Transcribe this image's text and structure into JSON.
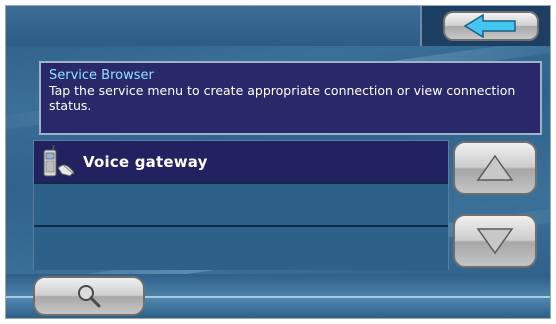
{
  "header": {
    "back_icon": "back-arrow-icon"
  },
  "info": {
    "title": "Service Browser",
    "description": "Tap the service menu to create appropriate connection or view connection status."
  },
  "services": [
    {
      "label": "Voice gateway",
      "icon": "phone-signal-icon"
    },
    {
      "label": ""
    },
    {
      "label": ""
    }
  ],
  "scroll": {
    "up_icon": "triangle-up-icon",
    "down_icon": "triangle-down-icon"
  },
  "footer": {
    "search_icon": "magnifier-icon"
  },
  "colors": {
    "background": "#2f628d",
    "panel": "#29296a",
    "title_cyan": "#8ee3ff",
    "selected_row": "#222260",
    "back_arrow": "#45c6f0"
  }
}
